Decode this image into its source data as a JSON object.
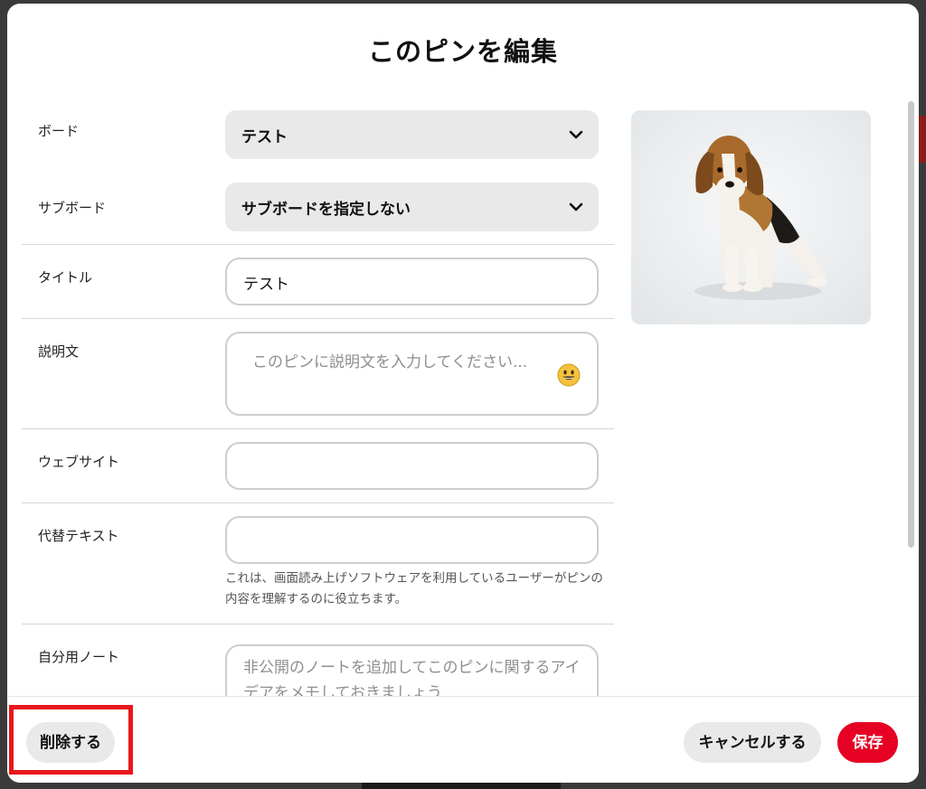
{
  "modal": {
    "title": "このピンを編集"
  },
  "form": {
    "board": {
      "label": "ボード",
      "value": "テスト"
    },
    "subboard": {
      "label": "サブボード",
      "value": "サブボードを指定しない"
    },
    "title": {
      "label": "タイトル",
      "value": "テスト"
    },
    "description": {
      "label": "説明文",
      "placeholder": "このピンに説明文を入力してください..."
    },
    "website": {
      "label": "ウェブサイト",
      "value": ""
    },
    "alt_text": {
      "label": "代替テキスト",
      "value": "",
      "help": "これは、画面読み上げソフトウェアを利用しているユーザーがピンの内容を理解するのに役立ちます。"
    },
    "note": {
      "label": "自分用ノート",
      "placeholder": "非公開のノートを追加してこのピンに関するアイデアをメモしておきましょう"
    }
  },
  "footer": {
    "delete_label": "削除する",
    "cancel_label": "キャンセルする",
    "save_label": "保存"
  },
  "colors": {
    "accent": "#e60023",
    "highlight": "#e8171b"
  }
}
